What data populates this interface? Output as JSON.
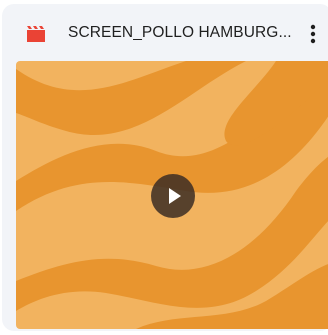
{
  "file_card": {
    "title": "SCREEN_POLLO HAMBURG...",
    "file_type_icon": "video-clapperboard-icon",
    "menu_icon": "more-vert-icon",
    "play_icon": "play-icon"
  },
  "colors": {
    "card_background": "#f2f4f8",
    "icon_red": "#ea4335",
    "thumbnail_light": "#f2b35f",
    "thumbnail_dark": "#e8952f",
    "play_button_bg": "#3c2d23"
  }
}
